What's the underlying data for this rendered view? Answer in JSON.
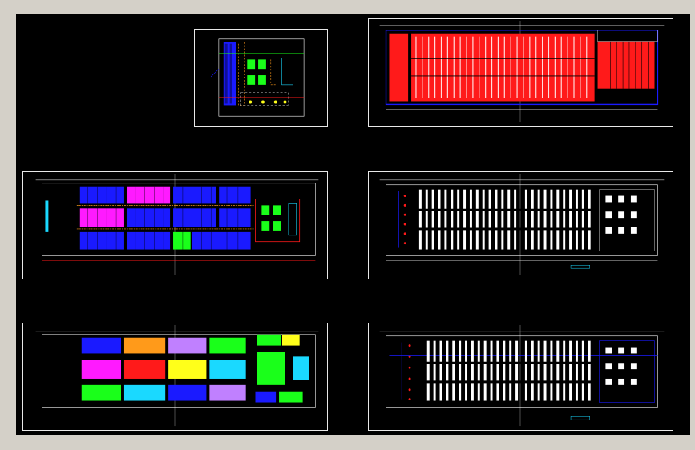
{
  "window": {
    "title": ""
  },
  "canvas": {
    "background": "#000000",
    "frame": "#d4d0c8",
    "line": "#ffffff"
  },
  "sheets": [
    {
      "id": "sheet-mezzanine",
      "caption": ""
    },
    {
      "id": "sheet-red-racking",
      "caption": ""
    },
    {
      "id": "sheet-color-zoning",
      "caption": ""
    },
    {
      "id": "sheet-white-racking-a",
      "caption": ""
    },
    {
      "id": "sheet-block-zoning",
      "caption": ""
    },
    {
      "id": "sheet-white-racking-b",
      "caption": ""
    }
  ],
  "colors": {
    "blue": "#1a1aff",
    "magenta": "#ff1aff",
    "red": "#ff1a1a",
    "green": "#1aff1a",
    "cyan": "#1ad9ff",
    "orange": "#ff9a1a",
    "yellow": "#ffff1a",
    "lavender": "#c080ff",
    "white": "#ffffff"
  },
  "icons": [
    "grid-mark-icon",
    "dimension-arrow-icon"
  ]
}
